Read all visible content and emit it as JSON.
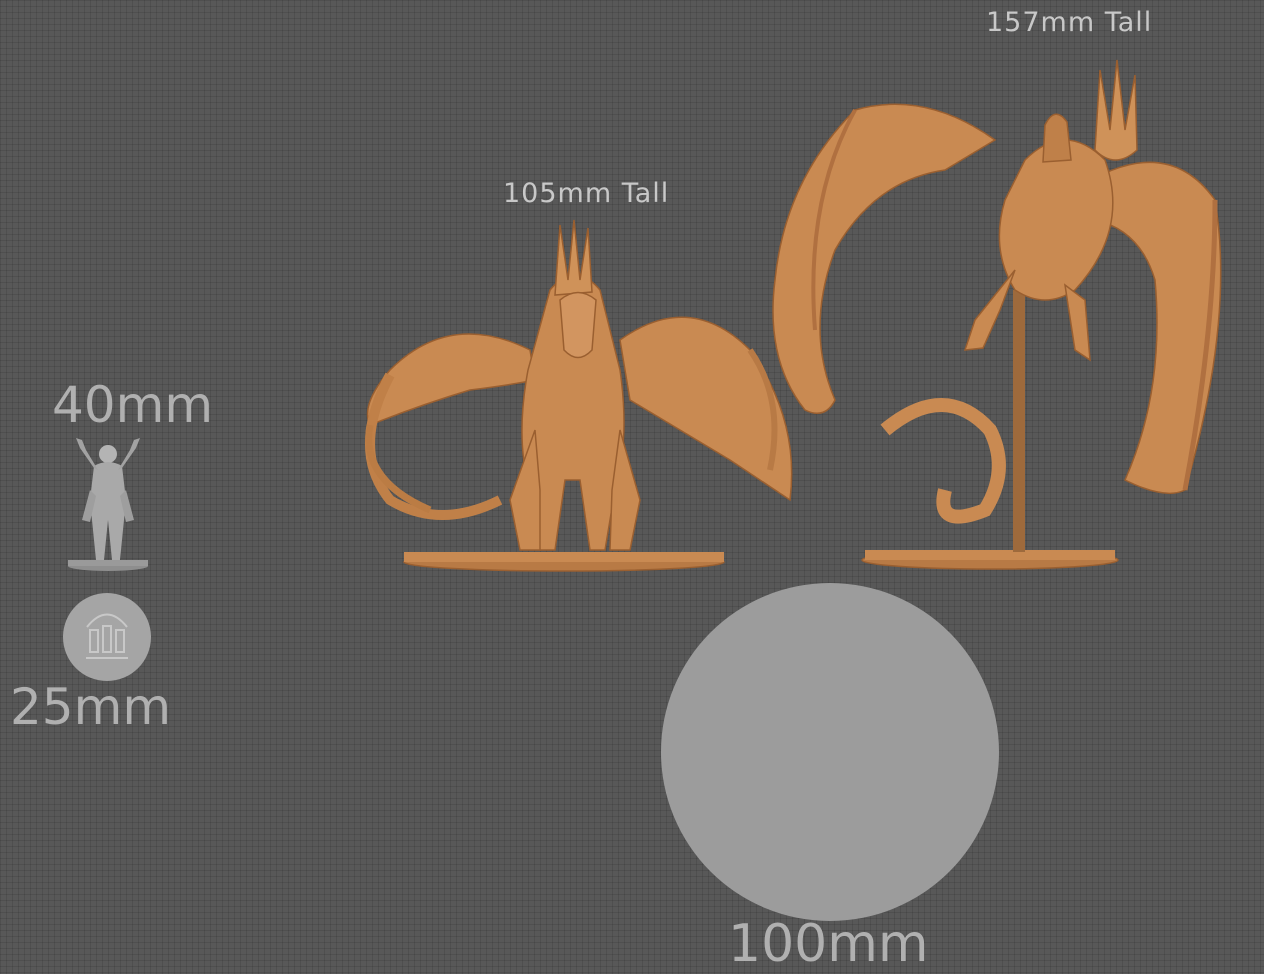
{
  "labels": {
    "tall_157": "157mm Tall",
    "tall_105": "105mm Tall",
    "size_40": "40mm",
    "size_25": "25mm",
    "size_100": "100mm"
  },
  "colors": {
    "background": "#585858",
    "model_resin": "#c98a52",
    "model_grey": "#a8a8a8",
    "base_circle": "#9c9c9c",
    "label_text": "#b9b9b9"
  }
}
